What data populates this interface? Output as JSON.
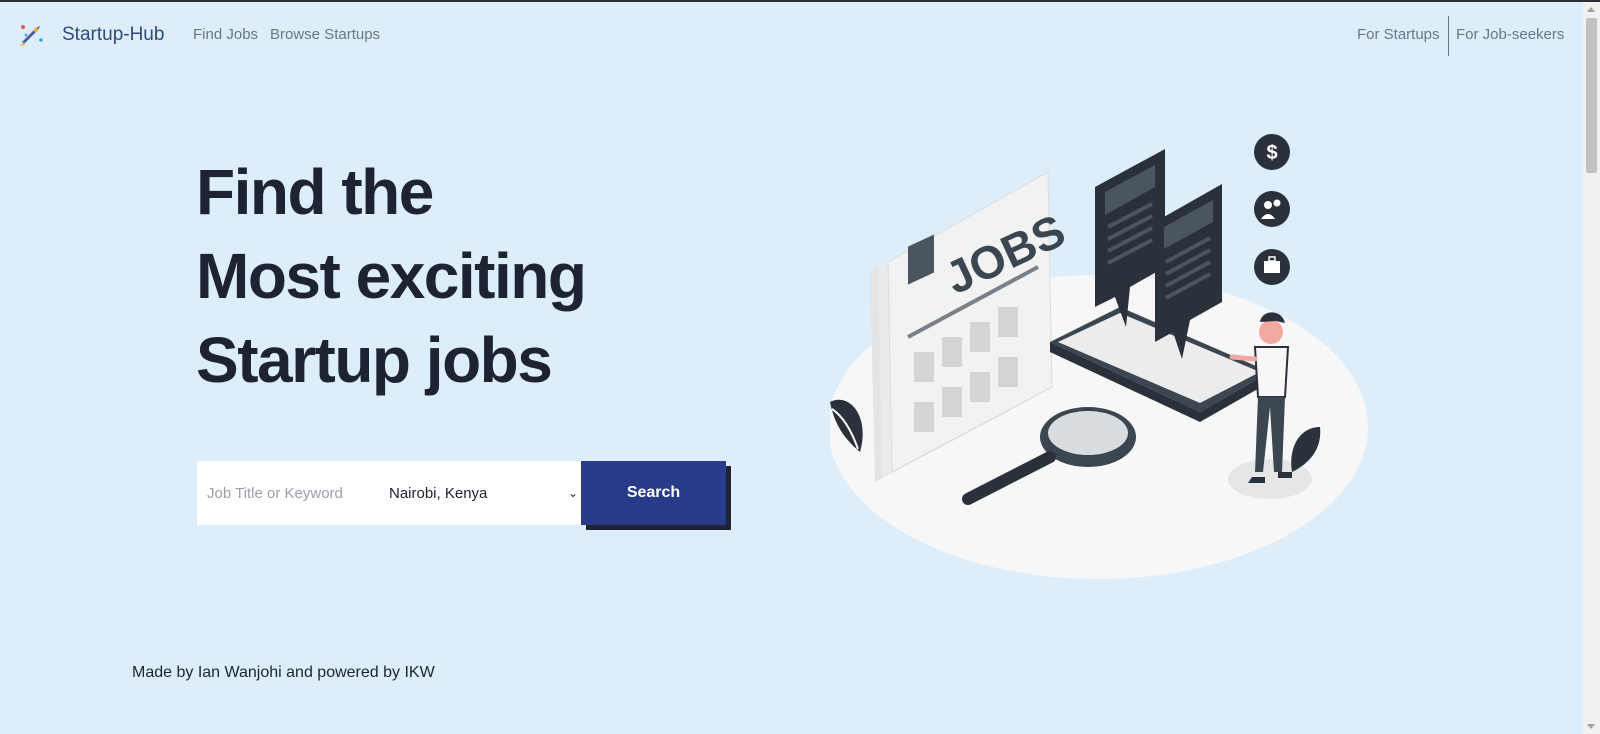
{
  "nav": {
    "brand": "Startup-Hub",
    "links_left": [
      "Find Jobs",
      "Browse Startups"
    ],
    "links_right": [
      "For Startups",
      "For Job-seekers"
    ]
  },
  "hero": {
    "lines": [
      "Find the",
      "Most exciting",
      "Startup jobs"
    ]
  },
  "search": {
    "placeholder": "Job Title or Keyword",
    "keyword_value": "",
    "location_selected": "Nairobi, Kenya",
    "button_label": "Search"
  },
  "illustration": {
    "sign_text": "JOBS",
    "icons": [
      "dollar-icon",
      "people-icon",
      "briefcase-icon"
    ]
  },
  "footer": {
    "text": "Made by Ian Wanjohi and powered by IKW"
  },
  "colors": {
    "background": "#ddeefa",
    "brand_text": "#2f4a7c",
    "heading": "#1d2330",
    "button": "#283a8a",
    "button_shadow": "#1d2330"
  }
}
